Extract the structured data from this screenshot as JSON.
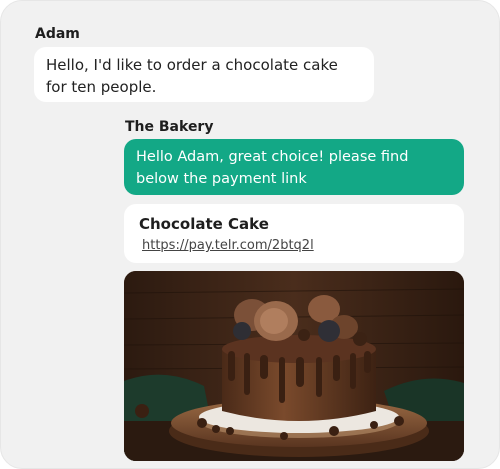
{
  "conversation": {
    "customer": {
      "name": "Adam",
      "message": "Hello, I'd like to order a chocolate cake for ten people."
    },
    "business": {
      "name": "The Bakery",
      "message": "Hello Adam, great choice! please find below the payment link"
    },
    "payment_link_card": {
      "title": "Chocolate Cake",
      "url": "https://pay.telr.com/2btq2l"
    },
    "image": {
      "subject": "chocolate drip cake on wooden board"
    }
  },
  "colors": {
    "background": "#f1f1f1",
    "outgoing_bubble": "#13a886",
    "incoming_bubble": "#ffffff"
  }
}
